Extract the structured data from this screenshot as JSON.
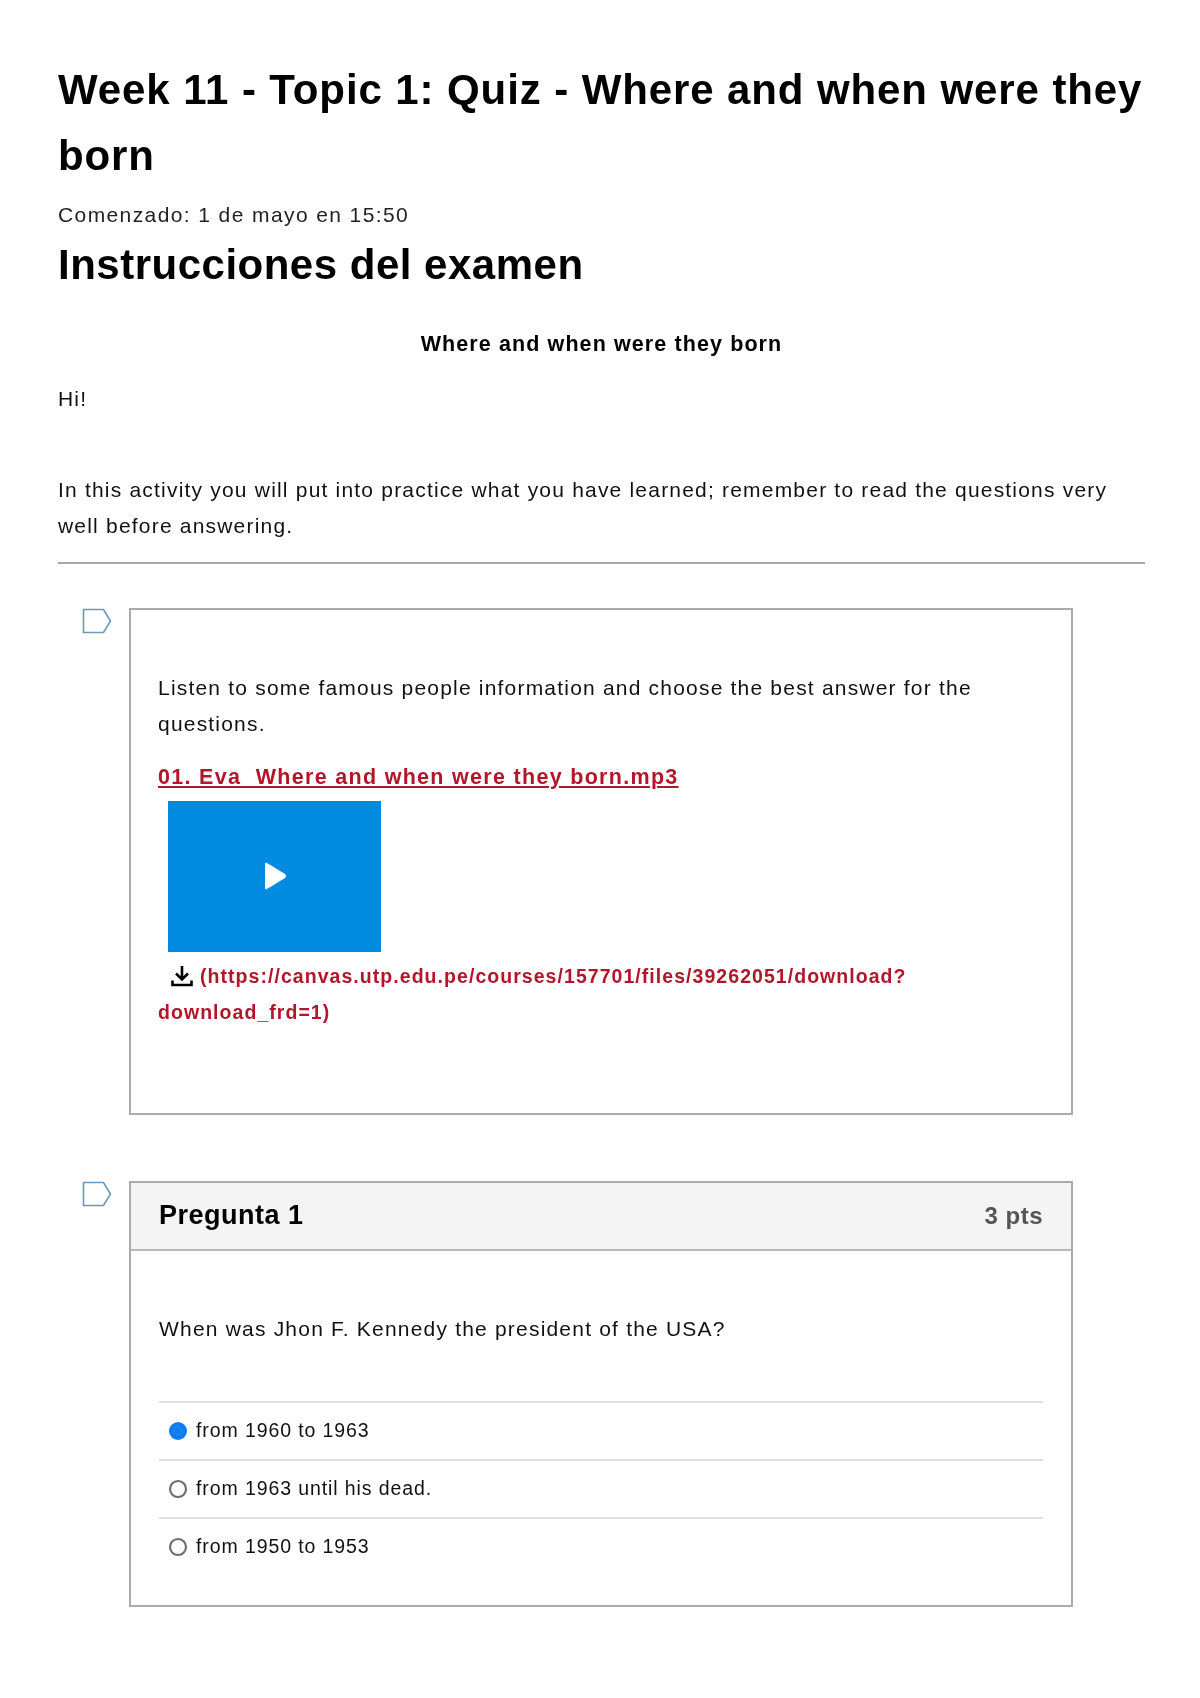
{
  "quiz": {
    "title": "Week 11 - Topic 1: Quiz - Where and when were they born",
    "started": "Comenzado: 1 de mayo en 15:50"
  },
  "instructions": {
    "heading": "Instrucciones del examen",
    "subtitle": "Where and when were they born",
    "paragraphs": [
      "Hi!",
      "In this activity you will put into practice what you have learned; remember to read the questions very well before answering."
    ]
  },
  "questions": [
    {
      "kind": "text_only",
      "text": "Listen to some famous people information and choose the best answer for the questions.",
      "audio": {
        "file_link": "01. Eva  Where and when were they born.mp3",
        "download_link": "(https://canvas.utp.edu.pe/courses/157701/files/39262051/download?download_frd=1)"
      }
    },
    {
      "kind": "multiple_choice",
      "title": "Pregunta 1",
      "points": "3 pts",
      "text": "When was Jhon F. Kennedy the president of the USA?",
      "answers": [
        {
          "label": "from 1960 to 1963",
          "selected": true
        },
        {
          "label": "from 1963 until his dead.",
          "selected": false
        },
        {
          "label": "from 1950 to 1953",
          "selected": false
        }
      ]
    }
  ]
}
